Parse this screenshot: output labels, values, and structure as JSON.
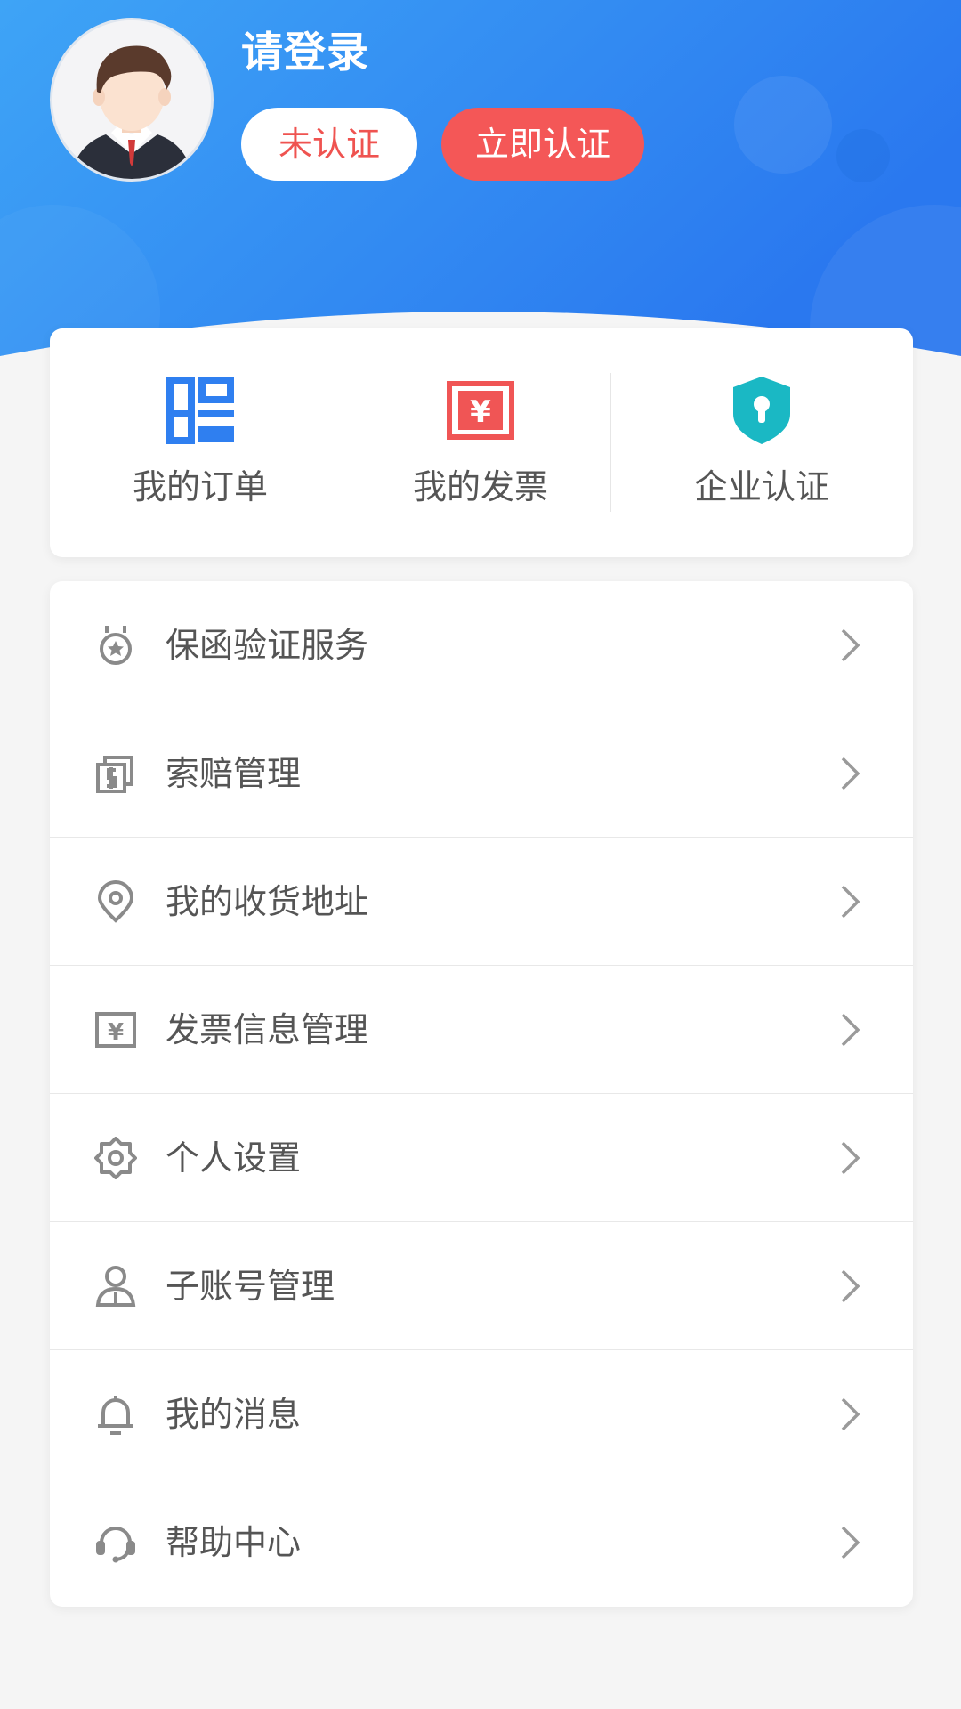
{
  "header": {
    "title": "请登录",
    "status_badge": "未认证",
    "verify_button": "立即认证",
    "gradient_start": "#3aa0f5",
    "gradient_end": "#2a7bf0"
  },
  "quick_actions": [
    {
      "label": "我的订单",
      "icon": "grid-icon",
      "color": "#2f7ff0"
    },
    {
      "label": "我的发票",
      "icon": "invoice-icon",
      "color": "#f05555"
    },
    {
      "label": "企业认证",
      "icon": "shield-lock-icon",
      "color": "#1ab8c4"
    }
  ],
  "menu": [
    {
      "label": "保函验证服务",
      "icon": "medal-icon"
    },
    {
      "label": "索赔管理",
      "icon": "money-stack-icon"
    },
    {
      "label": "我的收货地址",
      "icon": "location-pin-icon"
    },
    {
      "label": "发票信息管理",
      "icon": "invoice-icon"
    },
    {
      "label": "个人设置",
      "icon": "gear-icon"
    },
    {
      "label": "子账号管理",
      "icon": "user-icon"
    },
    {
      "label": "我的消息",
      "icon": "bell-icon"
    },
    {
      "label": "帮助中心",
      "icon": "headset-icon"
    }
  ],
  "colors": {
    "page_background": "#f5f5f5",
    "badge_text": "#ef5350",
    "verify_button_bg": "#f45757",
    "icon_gray": "#8a8a8a",
    "arrow_gray": "#9a9a9a"
  }
}
